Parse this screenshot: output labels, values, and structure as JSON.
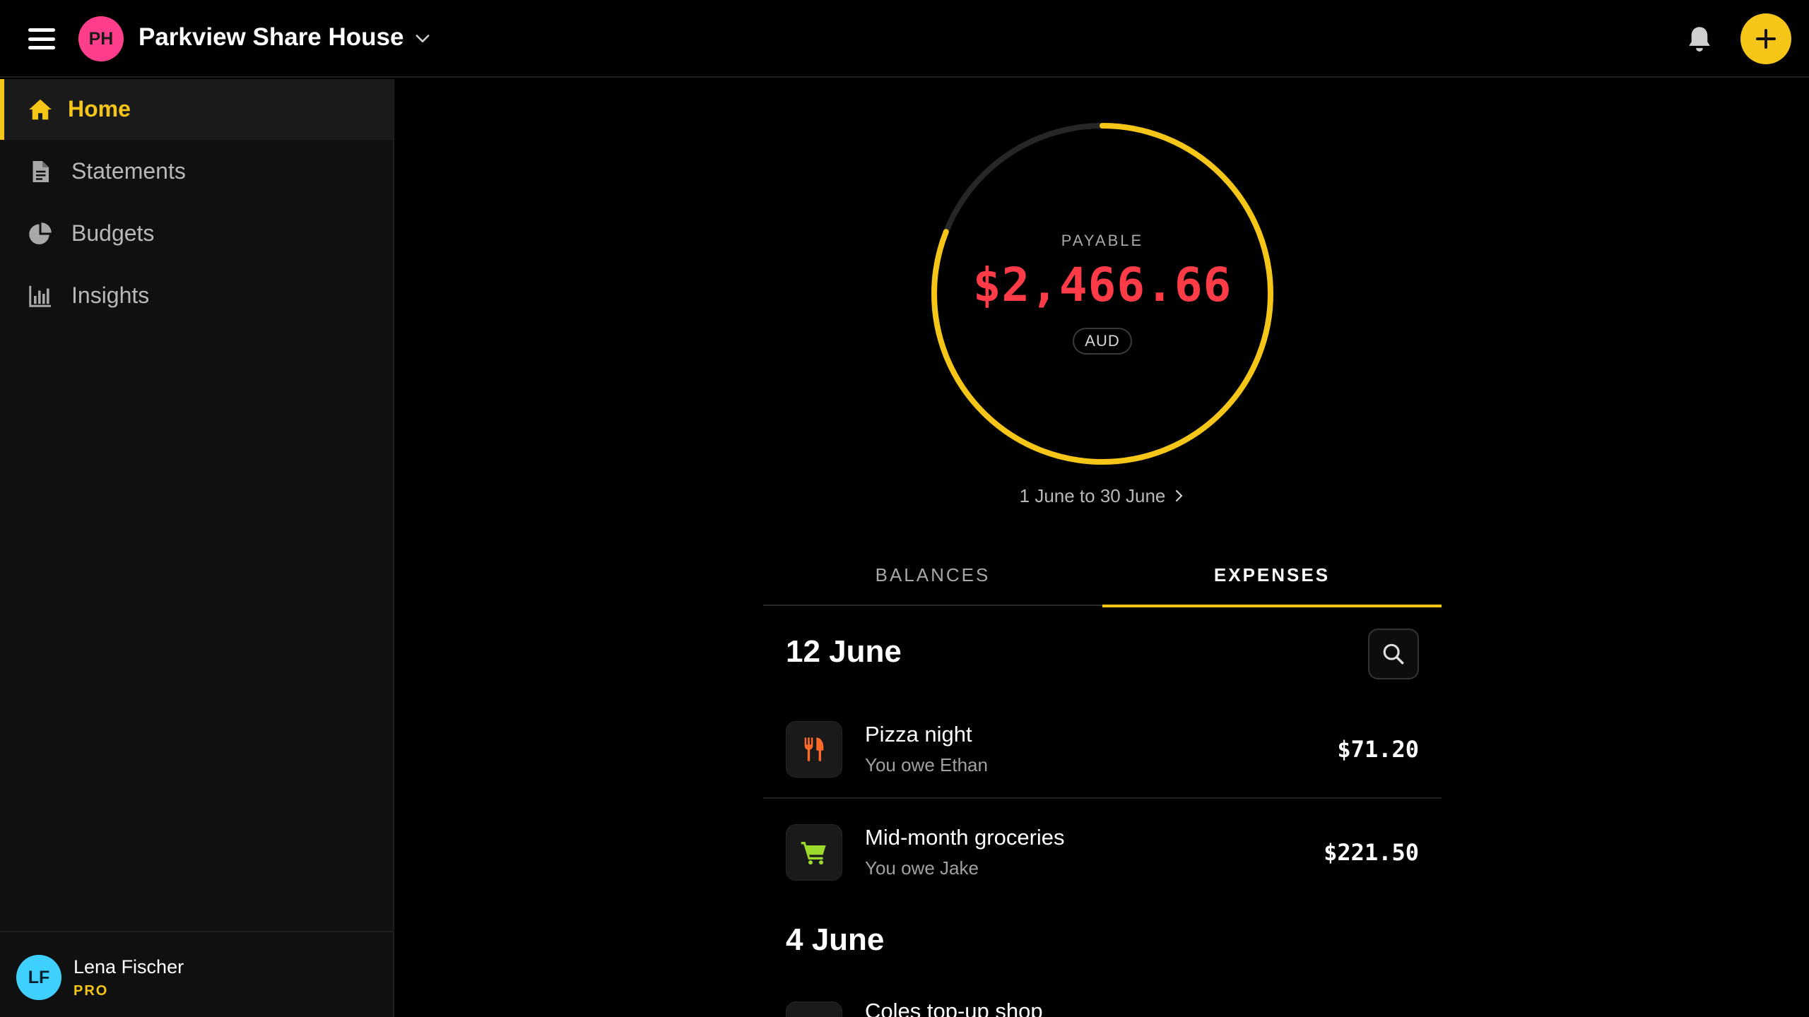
{
  "header": {
    "group_initials": "PH",
    "group_name": "Parkview Share House",
    "icons": [
      "menu-icon",
      "chevron-down-icon",
      "bell-icon",
      "plus-icon"
    ]
  },
  "sidebar": {
    "items": [
      {
        "label": "Home",
        "icon": "home-icon",
        "active": true
      },
      {
        "label": "Statements",
        "icon": "document-icon",
        "active": false
      },
      {
        "label": "Budgets",
        "icon": "pie-chart-icon",
        "active": false
      },
      {
        "label": "Insights",
        "icon": "bar-chart-icon",
        "active": false
      }
    ],
    "user": {
      "initials": "LF",
      "name": "Lena Fischer",
      "plan": "PRO"
    }
  },
  "summary": {
    "caption": "PAYABLE",
    "amount": "$2,466.66",
    "currency": "AUD",
    "period": "1 June to 30 June",
    "progress_fraction": 0.81
  },
  "tabs": [
    {
      "label": "BALANCES",
      "active": false
    },
    {
      "label": "EXPENSES",
      "active": true
    }
  ],
  "expense_groups": [
    {
      "date": "12 June",
      "items": [
        {
          "title": "Pizza night",
          "subtitle": "You owe Ethan",
          "amount": "$71.20",
          "icon": "cutlery-icon"
        },
        {
          "title": "Mid-month groceries",
          "subtitle": "You owe Jake",
          "amount": "$221.50",
          "icon": "shopping-cart-icon"
        }
      ]
    },
    {
      "date": "4 June",
      "items": [
        {
          "title": "Coles top-up shop",
          "subtitle": "",
          "amount": "",
          "icon": "shopping-cart-icon"
        }
      ]
    }
  ],
  "colors": {
    "accent": "#f5c518",
    "payable": "#ff3b47",
    "group_avatar": "#ff3d8b",
    "user_avatar": "#3ed1ff",
    "cutlery": "#ff6a2b",
    "cart": "#9bd92c"
  }
}
